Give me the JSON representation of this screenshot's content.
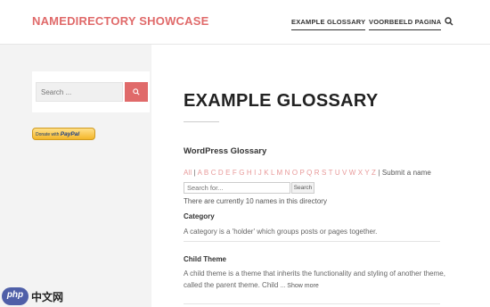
{
  "header": {
    "site_title": "NAMEDIRECTORY SHOWCASE",
    "nav": [
      "EXAMPLE GLOSSARY",
      "VOORBEELD PAGINA"
    ],
    "search_icon": "search-icon"
  },
  "sidebar": {
    "search_placeholder": "Search ...",
    "search_button_icon": "search-icon",
    "paypal": {
      "prefix": "Donate with",
      "brand": "PayPal"
    }
  },
  "main": {
    "page_title": "EXAMPLE GLOSSARY",
    "glossary_title": "WordPress Glossary",
    "alphabet": [
      "All",
      "A",
      "B",
      "C",
      "D",
      "E",
      "F",
      "G",
      "H",
      "I",
      "J",
      "K",
      "L",
      "M",
      "N",
      "O",
      "P",
      "Q",
      "R",
      "S",
      "T",
      "U",
      "V",
      "W",
      "X",
      "Y",
      "Z"
    ],
    "submit_link": "Submit a name",
    "search_placeholder": "Search for...",
    "search_button": "Search",
    "count_text": "There are currently 10 names in this directory",
    "entries": [
      {
        "term": "Category",
        "description": "A category is a 'holder' which groups posts or pages together."
      },
      {
        "term": "Child Theme",
        "description": "A child theme is a theme that inherits the functionality and styling of another theme, called the parent theme. Child",
        "more": "... Show more"
      }
    ]
  },
  "watermark": {
    "circle": "php",
    "text": "中文网"
  },
  "colors": {
    "accent": "#e06a6a",
    "link": "#e89a9a",
    "paypal": "#f4b629"
  }
}
